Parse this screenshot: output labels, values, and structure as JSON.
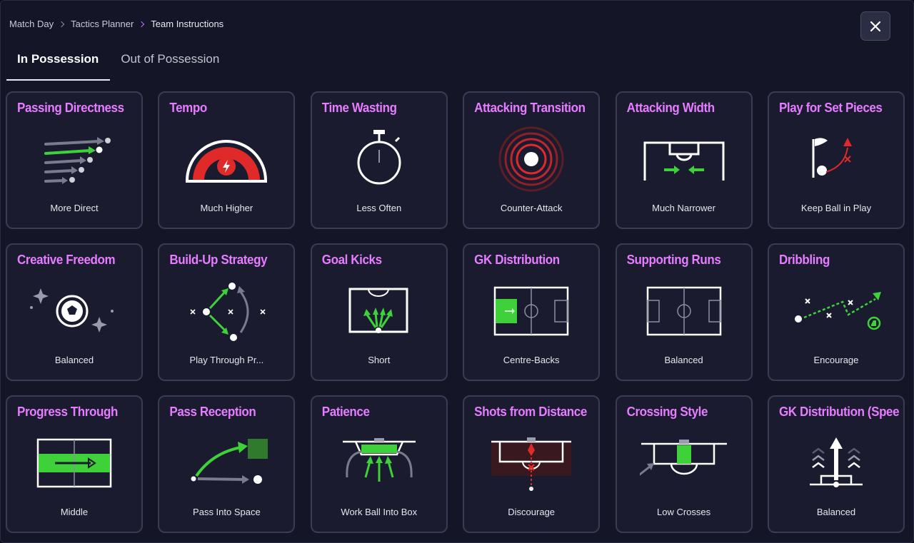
{
  "breadcrumb": [
    "Match Day",
    "Tactics Planner",
    "Team Instructions"
  ],
  "tabs": [
    "In Possession",
    "Out of Possession"
  ],
  "colors": {
    "accent": "#e67cff",
    "green": "#3ed13a",
    "red": "#e02a2a",
    "panel": "#1a1b2f"
  },
  "cards": [
    {
      "title": "Passing Directness",
      "value": "More Direct",
      "icon": "passing-directness-icon"
    },
    {
      "title": "Tempo",
      "value": "Much Higher",
      "icon": "tempo-gauge-icon"
    },
    {
      "title": "Time Wasting",
      "value": "Less Often",
      "icon": "stopwatch-icon"
    },
    {
      "title": "Attacking Transition",
      "value": "Counter-Attack",
      "icon": "counter-attack-target-icon"
    },
    {
      "title": "Attacking Width",
      "value": "Much Narrower",
      "icon": "attacking-width-pitch-icon"
    },
    {
      "title": "Play for Set Pieces",
      "value": "Keep Ball in Play",
      "icon": "corner-flag-icon"
    },
    {
      "title": "Creative Freedom",
      "value": "Balanced",
      "icon": "sparkle-ball-icon"
    },
    {
      "title": "Build-Up Strategy",
      "value": "Play Through Pr...",
      "icon": "build-up-passing-icon"
    },
    {
      "title": "Goal Kicks",
      "value": "Short",
      "icon": "goal-kick-box-icon"
    },
    {
      "title": "GK Distribution",
      "value": "Centre-Backs",
      "icon": "gk-distribution-pitch-icon"
    },
    {
      "title": "Supporting Runs",
      "value": "Balanced",
      "icon": "supporting-runs-pitch-icon"
    },
    {
      "title": "Dribbling",
      "value": "Encourage",
      "icon": "dribbling-path-icon"
    },
    {
      "title": "Progress Through",
      "value": "Middle",
      "icon": "progress-middle-pitch-icon"
    },
    {
      "title": "Pass Reception",
      "value": "Pass Into Space",
      "icon": "pass-into-space-icon"
    },
    {
      "title": "Patience",
      "value": "Work Ball Into Box",
      "icon": "work-into-box-icon"
    },
    {
      "title": "Shots from Distance",
      "value": "Discourage",
      "icon": "shots-distance-icon"
    },
    {
      "title": "Crossing Style",
      "value": "Low Crosses",
      "icon": "low-cross-icon"
    },
    {
      "title": "GK Distribution (Speed)",
      "value": "Balanced",
      "icon": "gk-speed-arrows-icon"
    }
  ]
}
